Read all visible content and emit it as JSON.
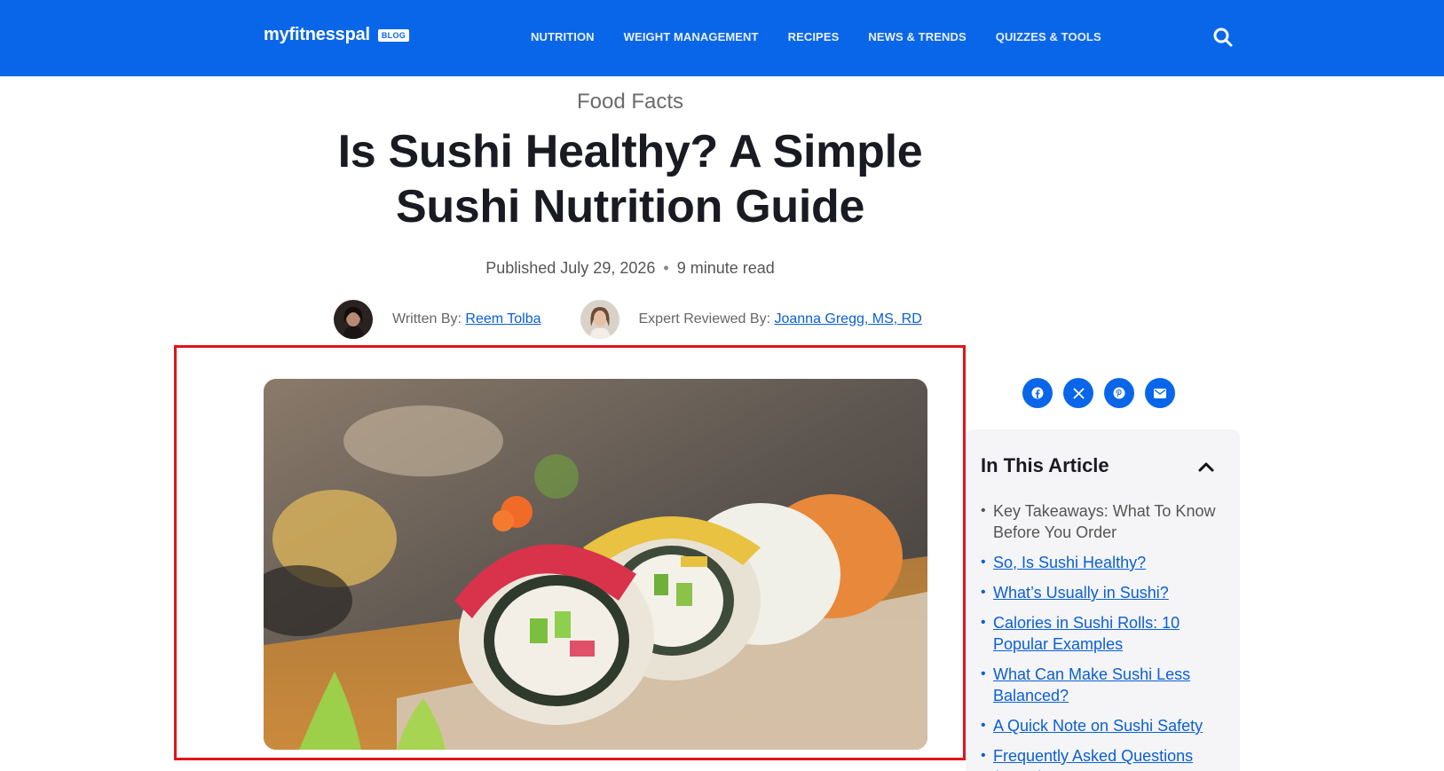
{
  "header": {
    "logo_text": "myfitnesspal",
    "logo_badge": "BLOG",
    "nav": [
      {
        "label": "NUTRITION"
      },
      {
        "label": "WEIGHT MANAGEMENT"
      },
      {
        "label": "RECIPES"
      },
      {
        "label": "NEWS & TRENDS"
      },
      {
        "label": "QUIZZES & TOOLS"
      }
    ],
    "search_icon": "search-icon"
  },
  "article": {
    "category": "Food Facts",
    "title": "Is Sushi Healthy? A Simple Sushi Nutrition Guide",
    "published": "Published July 29, 2026",
    "separator": "•",
    "read_time": "9 minute read",
    "author_label": "Written By:",
    "author_name": "Reem Tolba",
    "reviewer_label": "Expert Reviewed By:",
    "reviewer_name": "Joanna Gregg, MS, RD"
  },
  "share": {
    "icons": [
      "facebook-icon",
      "x-icon",
      "pinterest-icon",
      "email-icon"
    ]
  },
  "toc": {
    "heading": "In This Article",
    "toggle_icon": "chevron-up-icon",
    "items": [
      {
        "label": "Key Takeaways: What To Know Before You Order",
        "link": false
      },
      {
        "label": "So, Is Sushi Healthy?",
        "link": true
      },
      {
        "label": "What’s Usually in Sushi?",
        "link": true
      },
      {
        "label": "Calories in Sushi Rolls: 10 Popular Examples",
        "link": true
      },
      {
        "label": "What Can Make Sushi Less Balanced?",
        "link": true
      },
      {
        "label": "A Quick Note on Sushi Safety",
        "link": true
      },
      {
        "label": "Frequently Asked Questions (FAQs)",
        "link": true
      }
    ]
  },
  "colors": {
    "brand": "#0a66e8",
    "link": "#0a5fd6",
    "highlight": "#e0141b"
  }
}
